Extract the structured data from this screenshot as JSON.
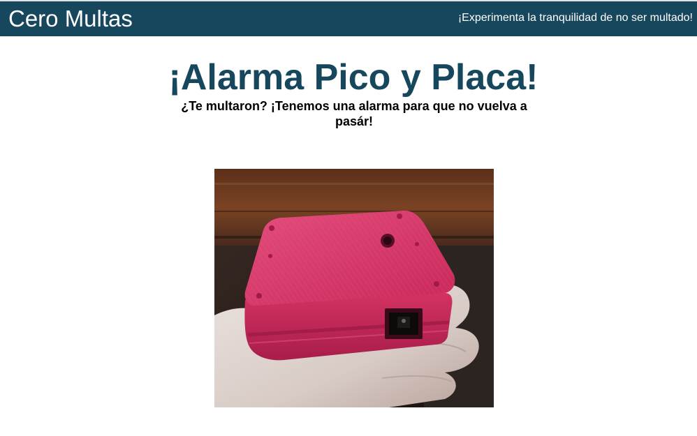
{
  "header": {
    "brand": "Cero Multas",
    "tagline": "¡Experimenta la tranquilidad de no ser multado!"
  },
  "hero": {
    "title": "¡Alarma Pico y Placa!",
    "subtitle": "¿Te multaron? ¡Tenemos una alarma para que no vuelva a pasár!"
  },
  "colors": {
    "header_background": "#17475d",
    "title_color": "#17475d",
    "device_color": "#d42a5f"
  }
}
